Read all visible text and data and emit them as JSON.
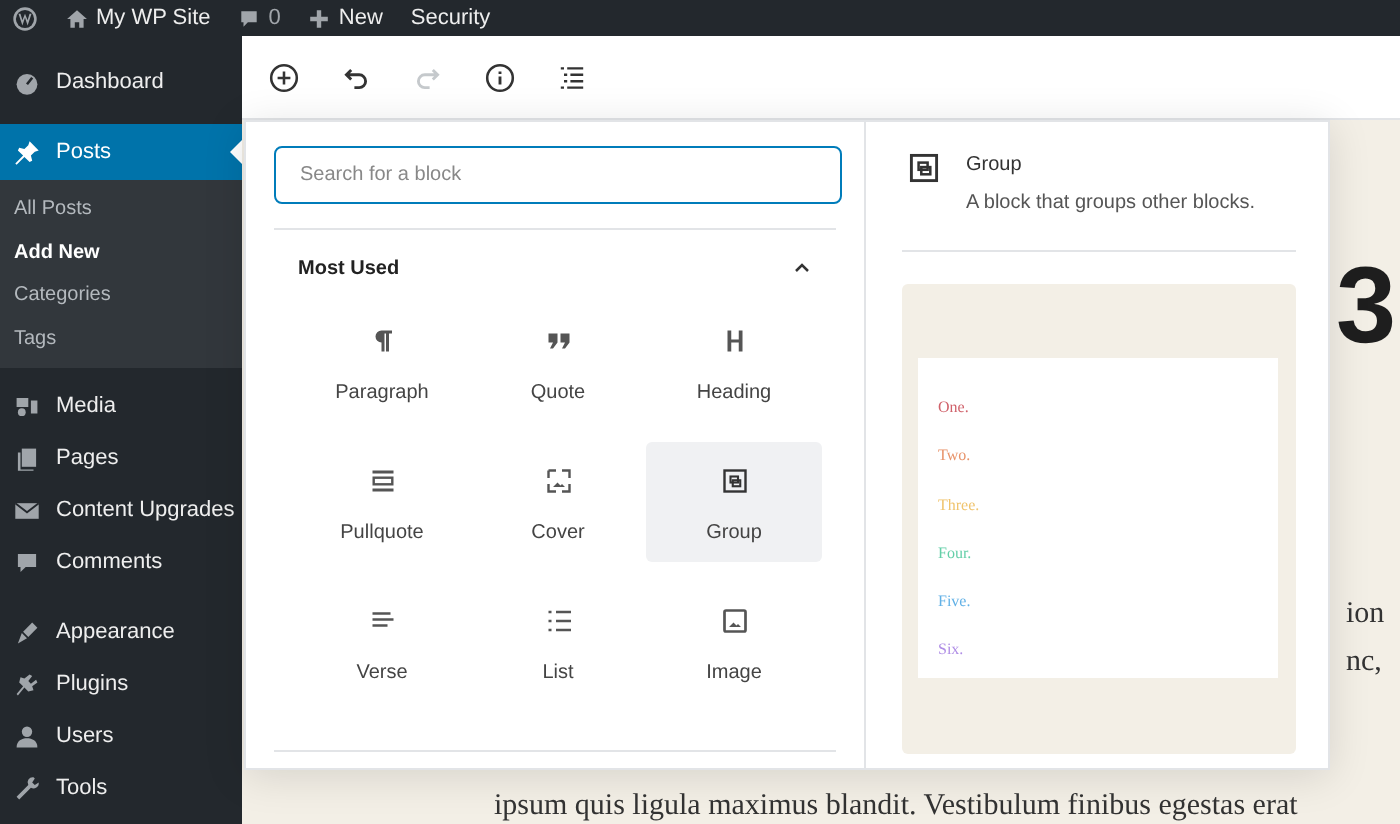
{
  "admin_bar": {
    "items": [
      {
        "kind": "wp-logo"
      },
      {
        "kind": "home",
        "label": "My WP Site"
      },
      {
        "kind": "comments",
        "label": "0"
      },
      {
        "kind": "new",
        "label": "New"
      },
      {
        "kind": "text",
        "label": "Security"
      }
    ]
  },
  "sidebar": {
    "items": [
      {
        "kind": "dashboard",
        "label": "Dashboard",
        "selected": false
      },
      {
        "kind": "posts",
        "label": "Posts",
        "selected": true,
        "children": [
          {
            "label": "All Posts",
            "selected": false
          },
          {
            "label": "Add New",
            "selected": true
          },
          {
            "label": "Categories",
            "selected": false
          },
          {
            "label": "Tags",
            "selected": false
          }
        ]
      },
      {
        "kind": "media",
        "label": "Media",
        "selected": false
      },
      {
        "kind": "pages",
        "label": "Pages",
        "selected": false
      },
      {
        "kind": "mail",
        "label": "Content Upgrades",
        "selected": false
      },
      {
        "kind": "comments",
        "label": "Comments",
        "selected": false
      },
      {
        "kind": "appearance",
        "label": "Appearance",
        "selected": false
      },
      {
        "kind": "plugins",
        "label": "Plugins",
        "selected": false
      },
      {
        "kind": "users",
        "label": "Users",
        "selected": false
      },
      {
        "kind": "tools",
        "label": "Tools",
        "selected": false
      }
    ]
  },
  "toolbar": {
    "items": [
      {
        "kind": "inserter",
        "disabled": false
      },
      {
        "kind": "undo",
        "disabled": false
      },
      {
        "kind": "redo",
        "disabled": true
      },
      {
        "kind": "info",
        "disabled": false
      },
      {
        "kind": "outline",
        "disabled": false
      }
    ]
  },
  "inserter": {
    "search": {
      "placeholder": "Search for a block"
    },
    "section": {
      "title": "Most Used",
      "expanded": true
    },
    "blocks": [
      {
        "kind": "paragraph",
        "label": "Paragraph",
        "selected": false
      },
      {
        "kind": "quote",
        "label": "Quote",
        "selected": false
      },
      {
        "kind": "heading",
        "label": "Heading",
        "selected": false
      },
      {
        "kind": "pullquote",
        "label": "Pullquote",
        "selected": false
      },
      {
        "kind": "cover",
        "label": "Cover",
        "selected": false
      },
      {
        "kind": "group",
        "label": "Group",
        "selected": true
      },
      {
        "kind": "verse",
        "label": "Verse",
        "selected": false
      },
      {
        "kind": "list",
        "label": "List",
        "selected": false
      },
      {
        "kind": "image",
        "label": "Image",
        "selected": false
      }
    ]
  },
  "preview": {
    "kind": "group",
    "title": "Group",
    "description": "A block that groups other blocks.",
    "lines": [
      {
        "text": "One.",
        "color": "#d0626b"
      },
      {
        "text": "Two.",
        "color": "#e8936a"
      },
      {
        "text": "Three.",
        "color": "#f0c46e"
      },
      {
        "text": "Four.",
        "color": "#64cfa8"
      },
      {
        "text": "Five.",
        "color": "#62b1e6"
      },
      {
        "text": "Six.",
        "color": "#b08ee6"
      }
    ]
  },
  "content": {
    "heading_fragment": "3",
    "text_fragments": [
      "ion",
      "nc,"
    ],
    "paragraph_line": "ipsum quis ligula maximus blandit. Vestibulum finibus egestas erat"
  }
}
